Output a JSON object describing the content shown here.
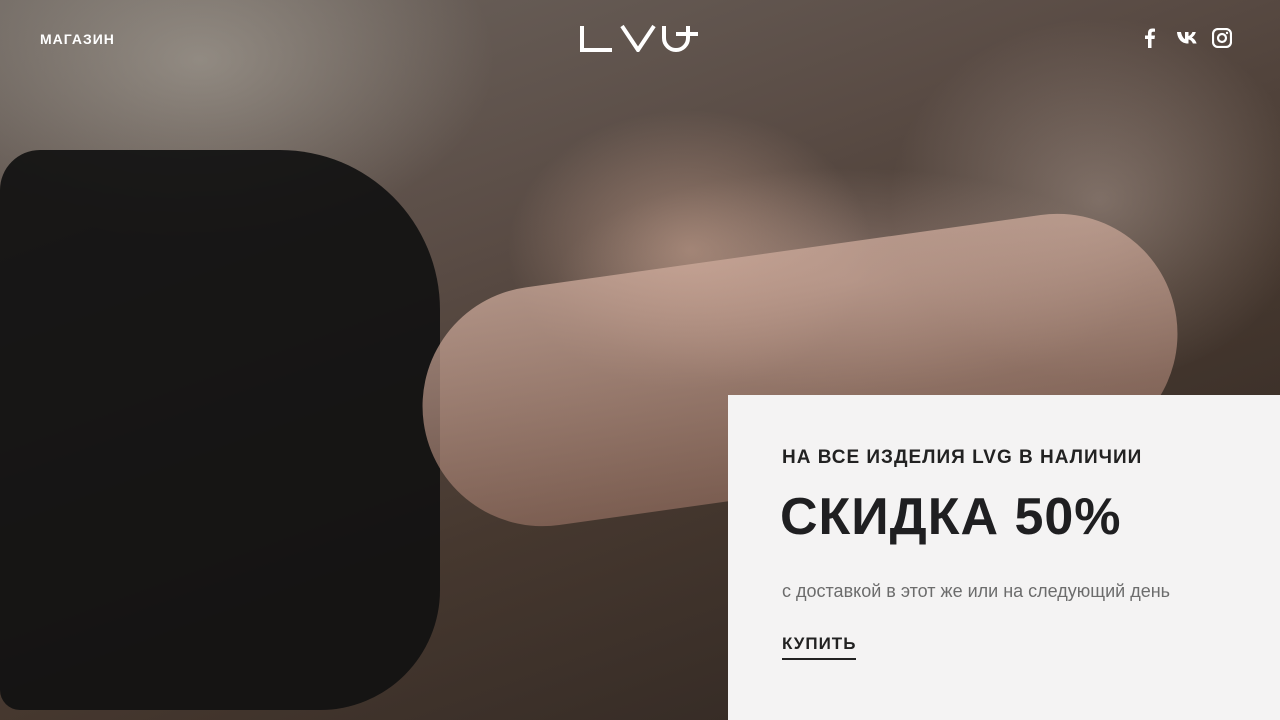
{
  "header": {
    "nav_shop": "МАГАЗИН",
    "logo_text": "LVG",
    "social": [
      "facebook-icon",
      "vk-icon",
      "instagram-icon"
    ]
  },
  "promo": {
    "subtitle": "НА ВСЕ ИЗДЕЛИЯ LVG В НАЛИЧИИ",
    "title": "СКИДКА 50%",
    "description": "с доставкой в этот же или на следующий день",
    "cta": "КУПИТЬ"
  },
  "colors": {
    "panel_bg": "#f4f3f3",
    "text_dark": "#1f1f21",
    "text_muted": "#6c6c6c"
  }
}
